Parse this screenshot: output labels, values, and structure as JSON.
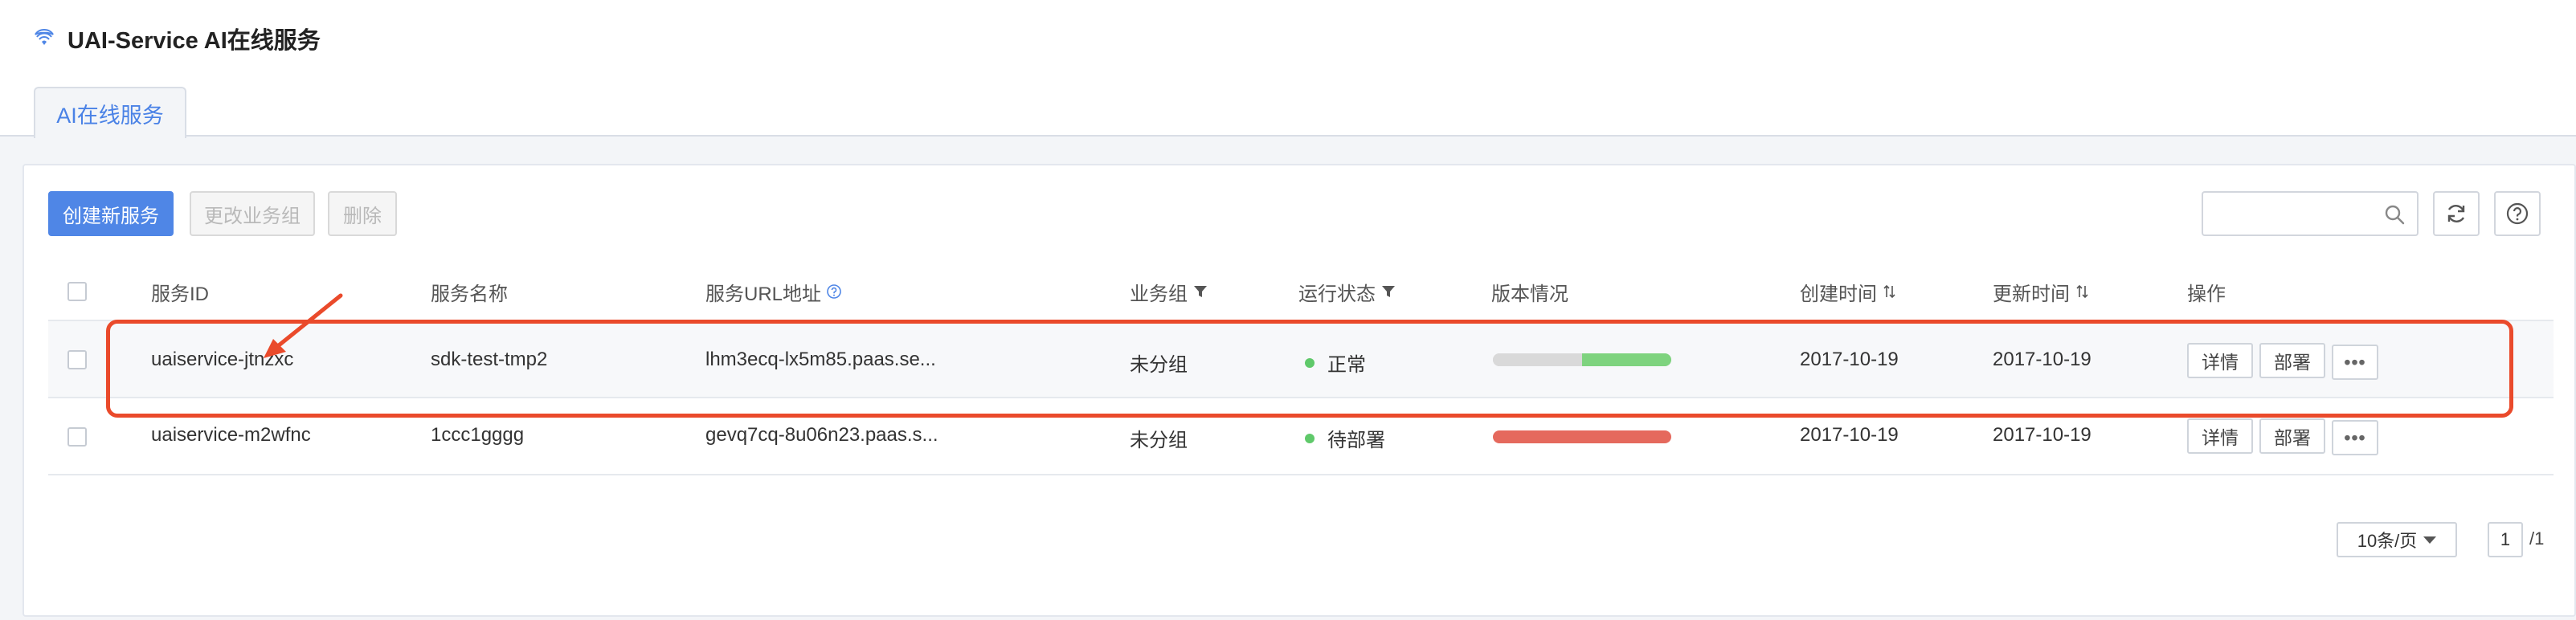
{
  "header": {
    "title": "UAI-Service AI在线服务",
    "active_tab": "AI在线服务"
  },
  "toolbar": {
    "create_label": "创建新服务",
    "change_group_label": "更改业务组",
    "delete_label": "删除",
    "search_placeholder": ""
  },
  "table": {
    "columns": {
      "service_id": "服务ID",
      "service_name": "服务名称",
      "service_url": "服务URL地址",
      "group": "业务组",
      "status": "运行状态",
      "version": "版本情况",
      "created": "创建时间",
      "updated": "更新时间",
      "actions": "操作"
    },
    "rows": [
      {
        "service_id": "uaiservice-jtnzxc",
        "service_name": "sdk-test-tmp2",
        "service_url": "lhm3ecq-lx5m85.paas.se...",
        "group": "未分组",
        "status": "正常",
        "status_color": "#5fc96a",
        "version_progress": 0.5,
        "version_colors": [
          "#d9d9d9",
          "#7ed37e"
        ],
        "created": "2017-10-19",
        "updated": "2017-10-19",
        "detail_label": "详情",
        "deploy_label": "部署",
        "more_label": "•••"
      },
      {
        "service_id": "uaiservice-m2wfnc",
        "service_name": "1ccc1gggg",
        "service_url": "gevq7cq-8u06n23.paas.s...",
        "group": "未分组",
        "status": "待部署",
        "status_color": "#5fc96a",
        "version_progress": 1.0,
        "version_colors": [
          "#e5695d"
        ],
        "created": "2017-10-19",
        "updated": "2017-10-19",
        "detail_label": "详情",
        "deploy_label": "部署",
        "more_label": "•••"
      }
    ]
  },
  "pagination": {
    "page_size": "10条/页",
    "current_page": "1",
    "total": "/1"
  },
  "colors": {
    "primary": "#4f86e6",
    "highlight": "#ea4a2b"
  }
}
